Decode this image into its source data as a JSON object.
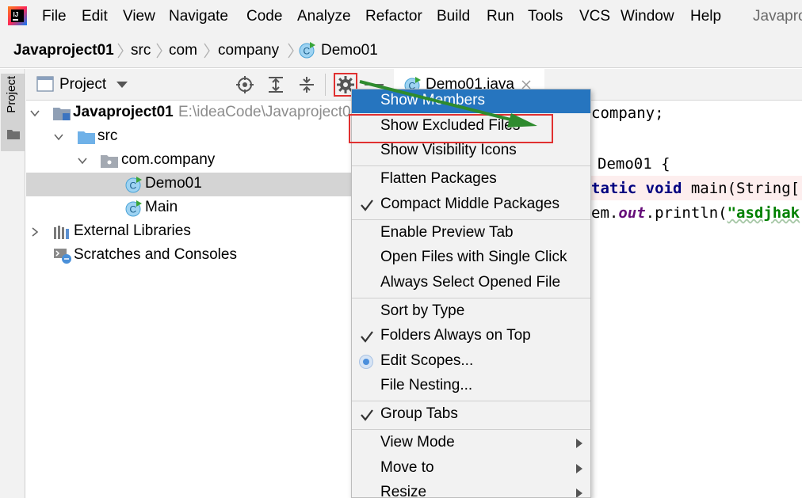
{
  "colors": {
    "menubar_bg": "#f2f2f2",
    "selection_bg": "#d4d4d4",
    "popup_highlight": "#2675bf",
    "annotation_red": "#e03030",
    "annotation_arrow": "#2e8b2e",
    "keyword": "#000080",
    "string": "#008000",
    "static_field": "#660e7a"
  },
  "menubar": {
    "logo_icon": "intellij-logo-icon",
    "items": [
      {
        "label": "File"
      },
      {
        "label": "Edit"
      },
      {
        "label": "View"
      },
      {
        "label": "Navigate"
      },
      {
        "label": "Code"
      },
      {
        "label": "Analyze"
      },
      {
        "label": "Refactor"
      },
      {
        "label": "Build"
      },
      {
        "label": "Run"
      },
      {
        "label": "Tools"
      },
      {
        "label": "VCS"
      },
      {
        "label": "Window"
      },
      {
        "label": "Help"
      }
    ],
    "window_title": "Javapro"
  },
  "breadcrumb": {
    "items": [
      {
        "label": "Javaproject01"
      },
      {
        "label": "src"
      },
      {
        "label": "com"
      },
      {
        "label": "company"
      },
      {
        "label": "Demo01",
        "icon": "java-class-icon"
      }
    ]
  },
  "tool_strip": {
    "project_label": "Project"
  },
  "project_panel": {
    "title": "Project",
    "tree": [
      {
        "label": "Javaproject01",
        "path": "E:\\ideaCode\\Javaproject0",
        "icon": "module-folder-icon"
      },
      {
        "label": "src",
        "icon": "source-folder-icon"
      },
      {
        "label": "com.company",
        "icon": "package-icon"
      },
      {
        "label": "Demo01",
        "icon": "java-class-icon",
        "selected": true
      },
      {
        "label": "Main",
        "icon": "java-class-icon"
      },
      {
        "label": "External Libraries",
        "icon": "libraries-icon"
      },
      {
        "label": "Scratches and Consoles",
        "icon": "scratches-icon"
      }
    ]
  },
  "editor": {
    "tab_label": "Demo01.java",
    "code_lines": [
      {
        "text": "company;"
      },
      {
        "kw": "",
        "text": "Demo01 {"
      },
      {
        "kw": "tatic void",
        "rest": " main(String["
      },
      {
        "pre": "em.",
        "field": "out",
        "mid": ".println(",
        "str": "\"asdjhak"
      }
    ]
  },
  "popup_menu": {
    "items": [
      {
        "label": "Show Members"
      },
      {
        "label": "Show Excluded Files"
      },
      {
        "label": "Show Visibility Icons"
      },
      {
        "label": "Flatten Packages"
      },
      {
        "label": "Compact Middle Packages",
        "checked": true
      },
      {
        "label": "Enable Preview Tab"
      },
      {
        "label": "Open Files with Single Click"
      },
      {
        "label": "Always Select Opened File"
      },
      {
        "label": "Sort by Type"
      },
      {
        "label": "Folders Always on Top",
        "checked": true
      },
      {
        "label": "Edit Scopes...",
        "radio": true
      },
      {
        "label": "File Nesting..."
      },
      {
        "label": "Group Tabs",
        "checked": true
      },
      {
        "label": "View Mode",
        "submenu": true
      },
      {
        "label": "Move to",
        "submenu": true
      },
      {
        "label": "Resize",
        "submenu": true
      }
    ]
  }
}
